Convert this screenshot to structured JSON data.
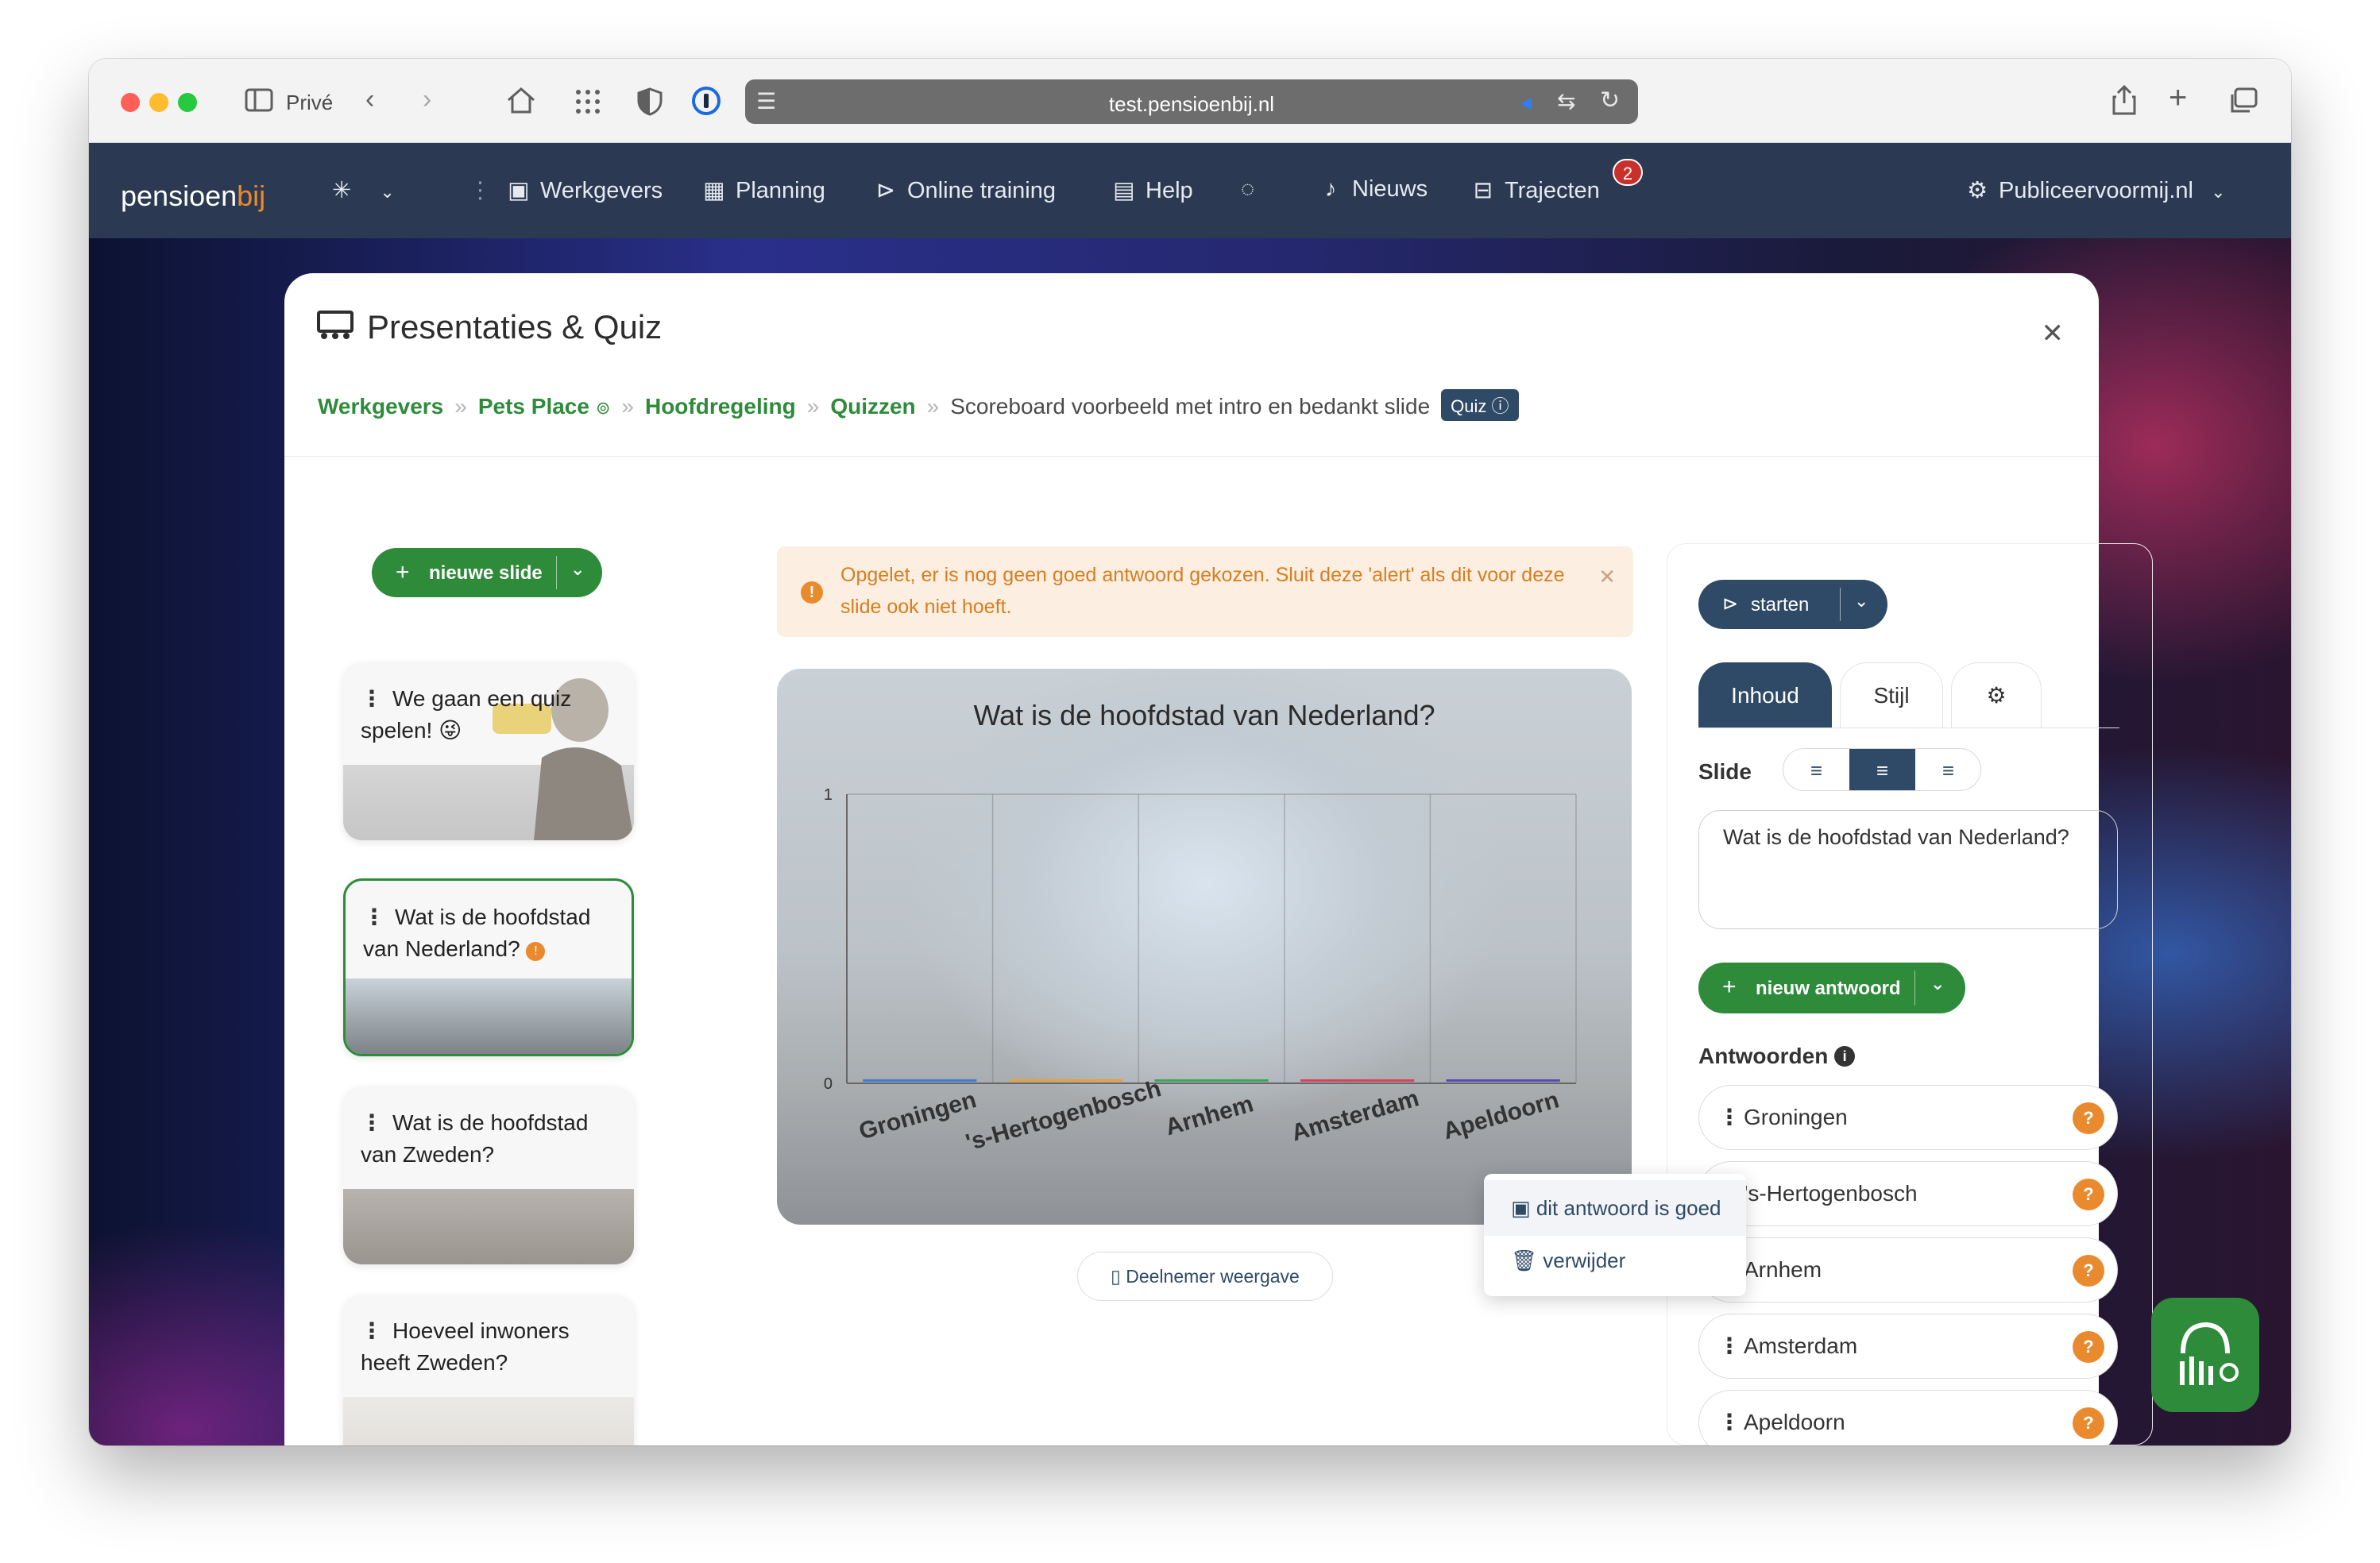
{
  "browser": {
    "profile_label": "Privé",
    "url": "test.pensioenbij.nl"
  },
  "nav": {
    "logo_prefix": "pensioen",
    "logo_suffix": "bij",
    "items": [
      {
        "label": "Werkgevers",
        "icon": "briefcase-icon"
      },
      {
        "label": "Planning",
        "icon": "calendar-icon"
      },
      {
        "label": "Online training",
        "icon": "play-circle-icon"
      },
      {
        "label": "Help",
        "icon": "book-icon"
      },
      {
        "label": "Nieuws",
        "icon": "bell-icon"
      },
      {
        "label": "Trajecten",
        "icon": "tray-icon"
      }
    ],
    "trajecten_badge": "2",
    "account_label": "Publiceervoormij.nl"
  },
  "modal": {
    "title": "Presentaties & Quiz",
    "breadcrumbs": [
      "Werkgevers",
      "Pets Place",
      "Hoofdregeling",
      "Quizzen"
    ],
    "current": "Scoreboard voorbeeld met intro en bedankt slide",
    "type_badge": "Quiz"
  },
  "slides_panel": {
    "new_slide_label": "nieuwe slide",
    "slides": [
      {
        "text": "We gaan een quiz spelen! 😜"
      },
      {
        "text": "Wat is de hoofdstad van Nederland?"
      },
      {
        "text": "Wat is de hoofdstad van Zweden?"
      },
      {
        "text": "Hoeveel inwoners heeft Zweden?"
      }
    ]
  },
  "alert": {
    "text": "Opgelet, er is nog geen goed antwoord gekozen. Sluit deze 'alert' als dit voor deze slide ook niet hoeft."
  },
  "preview_button": "Deelnemer weergave",
  "context_menu": {
    "items": [
      "dit antwoord is goed",
      "verwijder"
    ]
  },
  "editor": {
    "start_label": "starten",
    "tabs": [
      "Inhoud",
      "Stijl"
    ],
    "slide_label": "Slide",
    "question_text": "Wat is de hoofdstad van Nederland?",
    "new_answer_label": "nieuw antwoord",
    "answers_label": "Antwoorden",
    "answers": [
      "Groningen",
      "'s-Hertogenbosch",
      "Arnhem",
      "Amsterdam",
      "Apeldoorn"
    ]
  },
  "chart_data": {
    "type": "bar",
    "title": "Wat is de hoofdstad van Nederland?",
    "categories": [
      "Groningen",
      "'s-Hertogenbosch",
      "Arnhem",
      "Amsterdam",
      "Apeldoorn"
    ],
    "values": [
      0,
      0,
      0,
      0,
      0
    ],
    "ylim": [
      0,
      1
    ],
    "yticks": [
      "0",
      "1"
    ],
    "colors": [
      "#3a7bd5",
      "#e8a03a",
      "#3aa65a",
      "#d8425a",
      "#5a4ab5"
    ],
    "grid": true
  }
}
